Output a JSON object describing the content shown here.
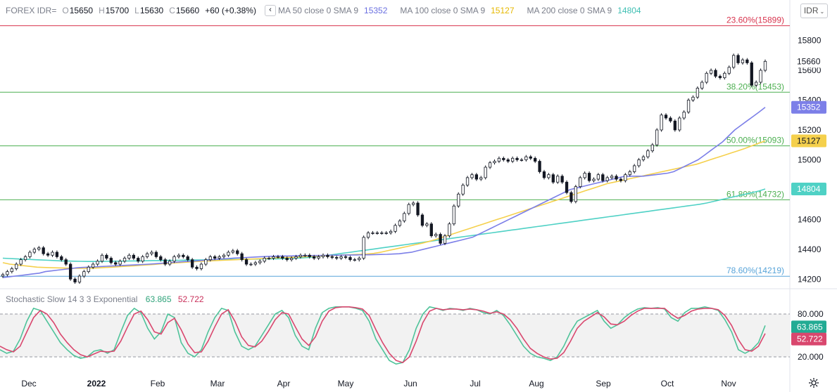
{
  "header": {
    "symbol": "FOREX IDR=",
    "o_key": "O",
    "o_val": "15650",
    "h_key": "H",
    "h_val": "15700",
    "l_key": "L",
    "l_val": "15630",
    "c_key": "C",
    "c_val": "15660",
    "change": "+60 (+0.38%)",
    "collapse_label": "‹",
    "ma50_label": "MA 50 close 0 SMA 9",
    "ma50_val": "15352",
    "ma100_label": "MA 100 close 0 SMA 9",
    "ma100_val": "15127",
    "ma200_label": "MA 200 close 0 SMA 9",
    "ma200_val": "14804"
  },
  "currency_button": "IDR",
  "stoch": {
    "label": "Stochastic Slow 14 3 3 Exponential",
    "k_val": "63.865",
    "d_val": "52.722"
  },
  "colors": {
    "ma50": "#7c7fe8",
    "ma100": "#f5d04c",
    "ma200": "#4fd1c5",
    "k": "#4fc39a",
    "d": "#d9476e",
    "fib_red": "#d8344e",
    "fib_green": "#4caf50",
    "fib_blue": "#58a4d9"
  },
  "chart_data": {
    "type": "candlestick",
    "price_axis": {
      "ticks": [
        14200,
        14400,
        14600,
        14800,
        15000,
        15200,
        15400,
        15600,
        15800
      ]
    },
    "x_ticks": [
      "Dec",
      "2022",
      "Feb",
      "Mar",
      "Apr",
      "May",
      "Jun",
      "Jul",
      "Aug",
      "Sep",
      "Oct",
      "Nov"
    ],
    "fib_levels": [
      {
        "label": "23.60%(15899)",
        "value": 15899,
        "color": "#d8344e"
      },
      {
        "label": "38.20%(15453)",
        "value": 15453,
        "color": "#4caf50"
      },
      {
        "label": "50.00%(15093)",
        "value": 15093,
        "color": "#4caf50"
      },
      {
        "label": "61.80%(14732)",
        "value": 14732,
        "color": "#4caf50"
      },
      {
        "label": "78.60%(14219)",
        "value": 14219,
        "color": "#58a4d9"
      }
    ],
    "last_price": "15660",
    "ma_labels": [
      {
        "text": "15352",
        "value": 15352,
        "color": "#7c7fe8"
      },
      {
        "text": "15127",
        "value": 15127,
        "color": "#f5d04c"
      },
      {
        "text": "14804",
        "value": 14804,
        "color": "#4fd1c5"
      }
    ],
    "close": [
      14230,
      14250,
      14270,
      14300,
      14330,
      14350,
      14380,
      14400,
      14410,
      14370,
      14360,
      14380,
      14350,
      14330,
      14300,
      14200,
      14180,
      14220,
      14250,
      14280,
      14300,
      14320,
      14360,
      14340,
      14310,
      14300,
      14320,
      14340,
      14360,
      14340,
      14320,
      14350,
      14370,
      14380,
      14350,
      14330,
      14300,
      14320,
      14350,
      14360,
      14350,
      14330,
      14280,
      14270,
      14300,
      14330,
      14350,
      14340,
      14350,
      14360,
      14380,
      14390,
      14370,
      14330,
      14300,
      14300,
      14310,
      14320,
      14340,
      14340,
      14350,
      14350,
      14340,
      14330,
      14340,
      14350,
      14360,
      14360,
      14350,
      14340,
      14350,
      14360,
      14350,
      14345,
      14340,
      14350,
      14345,
      14330,
      14330,
      14340,
      14480,
      14510,
      14510,
      14510,
      14510,
      14510,
      14520,
      14560,
      14590,
      14640,
      14700,
      14710,
      14630,
      14560,
      14570,
      14490,
      14500,
      14440,
      14490,
      14570,
      14690,
      14770,
      14830,
      14880,
      14900,
      14870,
      14880,
      14950,
      14980,
      14990,
      15010,
      15000,
      14990,
      15010,
      15000,
      15000,
      15020,
      15010,
      14990,
      14920,
      14880,
      14900,
      14850,
      14890,
      14850,
      14780,
      14720,
      14820,
      14880,
      14910,
      14860,
      14870,
      14900,
      14860,
      14880,
      14890,
      14870,
      14860,
      14900,
      14920,
      14960,
      15000,
      15020,
      15060,
      15100,
      15200,
      15300,
      15280,
      15260,
      15200,
      15280,
      15320,
      15400,
      15420,
      15480,
      15520,
      15580,
      15600,
      15560,
      15550,
      15580,
      15620,
      15700,
      15650,
      15670,
      15650,
      15500,
      15520,
      15600,
      15660
    ],
    "ma50": [
      14210,
      14215,
      14220,
      14225,
      14230,
      14235,
      14240,
      14250,
      14255,
      14260,
      14265,
      14270,
      14275,
      14278,
      14280,
      14282,
      14284,
      14286,
      14288,
      14290,
      14292,
      14294,
      14296,
      14298,
      14300,
      14303,
      14306,
      14309,
      14312,
      14315,
      14318,
      14320,
      14323,
      14326,
      14329,
      14332,
      14335,
      14338,
      14341,
      14343,
      14345,
      14347,
      14349,
      14351,
      14353,
      14354,
      14355,
      14355,
      14356,
      14357,
      14357,
      14358,
      14358,
      14359,
      14360,
      14360,
      14361,
      14362,
      14362,
      14363,
      14363,
      14364,
      14365,
      14366,
      14368,
      14370,
      14375,
      14380,
      14390,
      14400,
      14410,
      14420,
      14430,
      14440,
      14450,
      14460,
      14470,
      14480,
      14500,
      14520,
      14540,
      14560,
      14580,
      14600,
      14620,
      14640,
      14660,
      14680,
      14700,
      14720,
      14740,
      14760,
      14780,
      14800,
      14810,
      14820,
      14830,
      14840,
      14850,
      14860,
      14870,
      14880,
      14890,
      14890,
      14890,
      14890,
      14895,
      14900,
      14905,
      14910,
      14920,
      14940,
      14960,
      14980,
      15000,
      15030,
      15060,
      15090,
      15120,
      15160,
      15200,
      15230,
      15260,
      15290,
      15320,
      15352
    ],
    "ma100": [
      14310,
      14300,
      14295,
      14290,
      14285,
      14280,
      14278,
      14276,
      14275,
      14274,
      14273,
      14272,
      14272,
      14273,
      14275,
      14278,
      14280,
      14283,
      14286,
      14289,
      14292,
      14295,
      14298,
      14302,
      14305,
      14308,
      14311,
      14314,
      14317,
      14320,
      14322,
      14324,
      14326,
      14328,
      14330,
      14332,
      14334,
      14336,
      14338,
      14340,
      14342,
      14344,
      14346,
      14348,
      14350,
      14352,
      14354,
      14356,
      14358,
      14360,
      14362,
      14364,
      14366,
      14368,
      14372,
      14380,
      14390,
      14400,
      14410,
      14420,
      14430,
      14440,
      14452,
      14465,
      14480,
      14495,
      14510,
      14525,
      14540,
      14555,
      14570,
      14585,
      14600,
      14615,
      14630,
      14645,
      14660,
      14675,
      14690,
      14705,
      14720,
      14735,
      14750,
      14765,
      14780,
      14795,
      14810,
      14825,
      14840,
      14850,
      14860,
      14870,
      14880,
      14890,
      14900,
      14910,
      14920,
      14930,
      14940,
      14950,
      14960,
      14970,
      14985,
      15000,
      15015,
      15030,
      15045,
      15060,
      15075,
      15093,
      15110,
      15127
    ],
    "ma200": [
      14340,
      14338,
      14336,
      14334,
      14332,
      14330,
      14328,
      14326,
      14324,
      14322,
      14321,
      14320,
      14319,
      14318,
      14318,
      14318,
      14319,
      14320,
      14320,
      14321,
      14322,
      14322,
      14323,
      14324,
      14324,
      14325,
      14326,
      14326,
      14327,
      14328,
      14328,
      14329,
      14330,
      14330,
      14331,
      14332,
      14332,
      14333,
      14334,
      14334,
      14335,
      14335,
      14336,
      14337,
      14338,
      14340,
      14342,
      14345,
      14350,
      14355,
      14360,
      14366,
      14372,
      14378,
      14384,
      14390,
      14396,
      14402,
      14408,
      14414,
      14420,
      14426,
      14432,
      14438,
      14444,
      14450,
      14456,
      14462,
      14468,
      14474,
      14480,
      14486,
      14492,
      14498,
      14504,
      14510,
      14516,
      14522,
      14528,
      14534,
      14540,
      14546,
      14552,
      14558,
      14564,
      14570,
      14576,
      14582,
      14588,
      14594,
      14600,
      14606,
      14612,
      14618,
      14624,
      14630,
      14636,
      14642,
      14648,
      14654,
      14660,
      14666,
      14672,
      14678,
      14684,
      14690,
      14696,
      14702,
      14710,
      14720,
      14730,
      14740,
      14750,
      14760,
      14770,
      14780,
      14790,
      14804
    ],
    "stoch_axis": {
      "ticks": [
        "80.000",
        "20.000"
      ]
    },
    "stoch_k": [
      30,
      25,
      28,
      45,
      70,
      88,
      85,
      70,
      55,
      40,
      30,
      22,
      18,
      20,
      28,
      30,
      25,
      30,
      55,
      78,
      88,
      82,
      60,
      45,
      55,
      80,
      75,
      40,
      25,
      20,
      30,
      55,
      75,
      88,
      85,
      55,
      35,
      30,
      35,
      50,
      65,
      80,
      85,
      75,
      50,
      35,
      30,
      60,
      82,
      88,
      90,
      90,
      90,
      88,
      85,
      70,
      45,
      30,
      15,
      10,
      12,
      30,
      60,
      80,
      90,
      88,
      85,
      88,
      87,
      85,
      88,
      86,
      82,
      80,
      85,
      78,
      65,
      50,
      35,
      25,
      20,
      18,
      15,
      20,
      35,
      55,
      70,
      75,
      80,
      85,
      70,
      60,
      65,
      75,
      82,
      87,
      89,
      88,
      89,
      87,
      75,
      70,
      82,
      88,
      88,
      90,
      88,
      85,
      72,
      55,
      30,
      25,
      30,
      40,
      64
    ],
    "stoch_d": [
      35,
      30,
      27,
      35,
      55,
      75,
      85,
      80,
      68,
      52,
      40,
      30,
      23,
      20,
      24,
      28,
      27,
      28,
      42,
      62,
      80,
      84,
      72,
      55,
      52,
      68,
      74,
      58,
      38,
      26,
      27,
      42,
      62,
      80,
      86,
      70,
      48,
      36,
      34,
      42,
      56,
      72,
      82,
      80,
      62,
      45,
      36,
      48,
      70,
      84,
      89,
      90,
      90,
      89,
      87,
      78,
      58,
      40,
      25,
      15,
      12,
      20,
      42,
      68,
      84,
      88,
      86,
      87,
      87,
      86,
      87,
      86,
      84,
      81,
      83,
      80,
      72,
      60,
      45,
      32,
      25,
      20,
      17,
      18,
      26,
      42,
      60,
      70,
      76,
      82,
      76,
      66,
      65,
      70,
      78,
      84,
      88,
      88,
      88,
      88,
      80,
      74,
      78,
      84,
      87,
      88,
      88,
      86,
      78,
      64,
      44,
      30,
      28,
      35,
      52.722
    ]
  }
}
